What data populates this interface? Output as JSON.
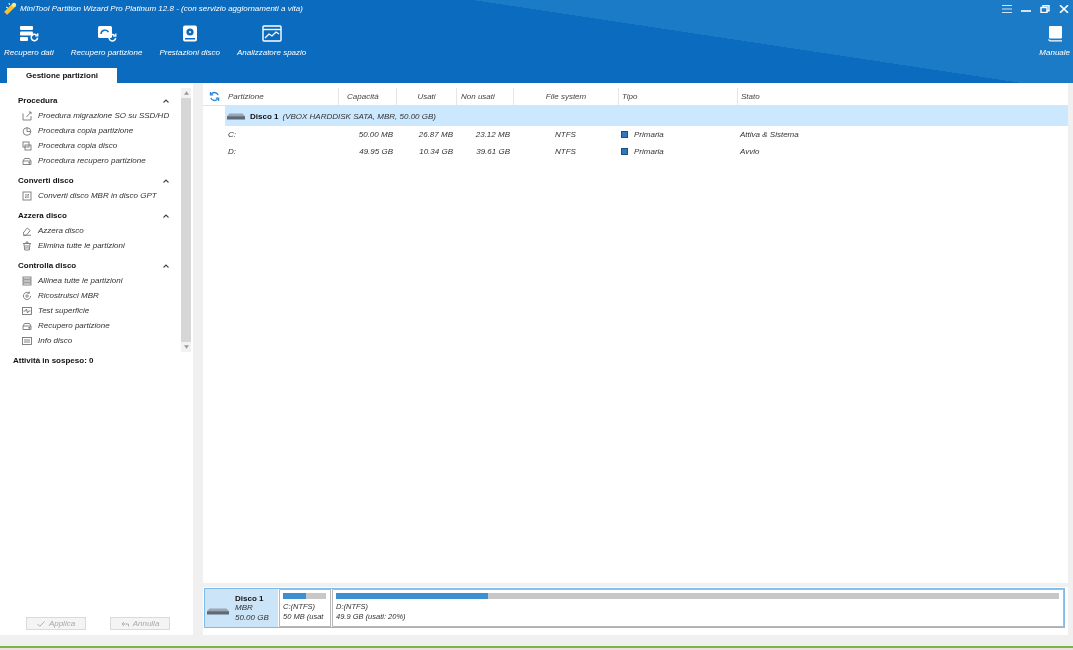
{
  "window": {
    "title": "MiniTool Partition Wizard Pro Platinum 12.8 - (con servizio aggiornamenti a vita)"
  },
  "toolbar": [
    {
      "label": "Recupero dati"
    },
    {
      "label": "Recupero partizione"
    },
    {
      "label": "Prestazioni disco"
    },
    {
      "label": "Analizzatore spazio"
    }
  ],
  "manual": {
    "label": "Manuale"
  },
  "tabs": [
    {
      "label": "Gestione partizioni",
      "selected": true
    }
  ],
  "sidebar": {
    "sections": [
      {
        "title": "Procedura",
        "expanded": true,
        "items": [
          "Proedura migrazione SO su SSD/HD",
          "Procedura copia partizione",
          "Procedura copia disco",
          "Procedura recupero partizione"
        ]
      },
      {
        "title": "Converti disco",
        "expanded": true,
        "items": [
          "Converti disco MBR in disco GPT"
        ]
      },
      {
        "title": "Azzera disco",
        "expanded": true,
        "items": [
          "Azzera disco",
          "Elimina tutte le partizioni"
        ]
      },
      {
        "title": "Controlla disco",
        "expanded": true,
        "items": [
          "Allinea tutte le partizioni",
          "Ricostruisci MBR",
          "Test superficie",
          "Recupero partizione",
          "Info disco"
        ]
      }
    ],
    "pending": "Attività in sospeso: 0",
    "actions": [
      {
        "label": "Applica",
        "disabled": true
      },
      {
        "label": "Annulla",
        "disabled": true
      }
    ]
  },
  "table": {
    "columns": [
      "Partizione",
      "Capacità",
      "Usati",
      "Non usati",
      "File system",
      "Tipo",
      "Stato"
    ],
    "disks": [
      {
        "name": "Disco 1",
        "details": "(VBOX HARDDISK SATA, MBR, 50.00 GB)",
        "selected": true,
        "partitions": [
          {
            "partition": "C:",
            "capacity": "50.00 MB",
            "used": "26.87 MB",
            "unused": "23.12 MB",
            "file_system": "NTFS",
            "type": "Primaria",
            "status": "Attiva & Sistema",
            "selected": false
          },
          {
            "partition": "D:",
            "capacity": "49.95 GB",
            "used": "10.34 GB",
            "unused": "39.61 GB",
            "file_system": "NTFS",
            "type": "Primaria",
            "status": "Avvio",
            "selected": false
          }
        ]
      }
    ]
  },
  "disk_map": {
    "disks": [
      {
        "name": "Disco 1",
        "scheme": "MBR",
        "size": "50.00 GB",
        "selected": true,
        "partitions": [
          {
            "label": "C:(NTFS)",
            "info": "50 MB (usat",
            "level": 0.54
          },
          {
            "label": "D:(NTFS)",
            "info": "49.9 GB (usati: 20%)",
            "level": 0.21
          }
        ]
      }
    ]
  }
}
